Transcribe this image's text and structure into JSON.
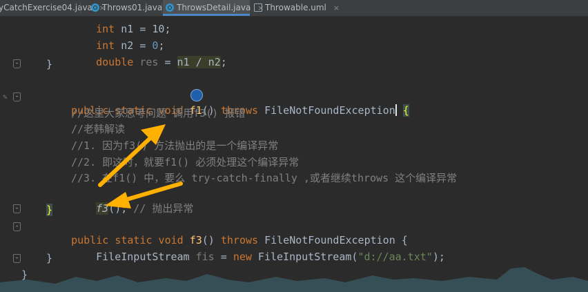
{
  "tabs": [
    {
      "label": "yCatchExercise04.java",
      "active": false
    },
    {
      "label": "Throws01.java",
      "active": false
    },
    {
      "label": "ThrowsDetail.java",
      "active": true
    },
    {
      "label": "Throwable.uml",
      "active": false
    }
  ],
  "close_glyph": "×",
  "code": {
    "l0": {
      "kw": "int",
      "rest": " n1 = 10;"
    },
    "l1": {
      "kw": "int",
      "mid": " n2 = ",
      "num": "0",
      "end": ";"
    },
    "l2": {
      "kw": "double",
      "var": " res",
      "eq": " = ",
      "expr": "n1 / n2",
      "end": ";"
    },
    "l3": "}",
    "l5": {
      "kw": "public static void",
      "fn": " f1",
      "paren": "()",
      "throws": " throws",
      "cls": " FileNotFoundException",
      "brace": "{"
    },
    "l6": "//这里大家思考问题 调用f3() 报错",
    "l7": "//老韩解读",
    "l8": "//1. 因为f3() 方法抛出的是一个编译异常",
    "l9": "//2. 即这时，就要f1() 必须处理这个编译异常",
    "l10": "//3. 在f1() 中，要么 try-catch-finally ,或者继续throws 这个编译异常",
    "l11": {
      "call": "f3",
      "paren": "();",
      "cmt": " // 抛出异常"
    },
    "l12": "}",
    "l13": {
      "kw": "public static void",
      "fn": " f3",
      "paren": "()",
      "throws": " throws",
      "cls": " FileNotFoundException {"
    },
    "l14": {
      "cls": "FileInputStream",
      "var": " fis",
      "eq": " = ",
      "kw": "new",
      "cls2": " FileInputStream(",
      "str": "\"d://aa.txt\"",
      "end": ");"
    },
    "l15": "}",
    "l16": "}"
  },
  "colors": {
    "background": "#2b2b2b",
    "keyword": "#cc7832",
    "string": "#6a8759",
    "comment": "#808080",
    "function": "#ffc66d",
    "arrow": "#ffb000"
  }
}
